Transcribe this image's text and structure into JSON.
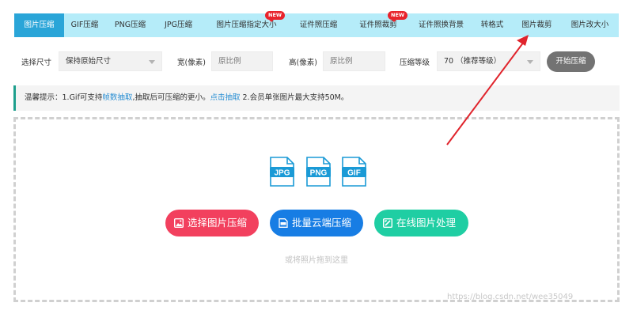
{
  "nav": {
    "items": [
      {
        "label": "图片压缩",
        "active": true
      },
      {
        "label": "GIF压缩"
      },
      {
        "label": "PNG压缩"
      },
      {
        "label": "JPG压缩"
      },
      {
        "label": "图片压缩指定大小",
        "badge": "NEW"
      },
      {
        "label": "证件照压缩"
      },
      {
        "label": "证件照裁剪",
        "badge": "NEW"
      },
      {
        "label": "证件照换背景"
      },
      {
        "label": "转格式"
      },
      {
        "label": "图片裁剪"
      },
      {
        "label": "图片改大小"
      }
    ]
  },
  "options": {
    "size_label": "选择尺寸",
    "size_value": "保持原始尺寸",
    "width_label": "宽(像素)",
    "width_placeholder": "原比例",
    "height_label": "高(像素)",
    "height_placeholder": "原比例",
    "level_label": "压缩等级",
    "level_value": "70 （推荐等级）",
    "start_label": "开始压缩"
  },
  "tip": {
    "prefix": "温馨提示：1.Gif可支持",
    "link1": "帧数抽取",
    "mid": ",抽取后可压缩的更小。",
    "link2": "点击抽取",
    "suffix": " 2.会员单张图片最大支持50M。"
  },
  "formats": [
    "JPG",
    "PNG",
    "GIF"
  ],
  "actions": {
    "select_label": "选择图片压缩",
    "batch_label": "批量云端压缩",
    "online_label": "在线图片处理"
  },
  "hint": "或将照片拖到这里",
  "watermark": "https://blog.csdn.net/wee35049",
  "colors": {
    "nav_bg": "#b5ecf9",
    "nav_active": "#2aa5d8",
    "badge": "#e8242c",
    "tip_border": "#1e9f8d",
    "link": "#2a8fd3",
    "btn_red": "#f2405e",
    "btn_blue": "#177de4",
    "btn_green": "#1fcea3",
    "format_icon": "#1a9ad6",
    "arrow": "#e0242c"
  }
}
